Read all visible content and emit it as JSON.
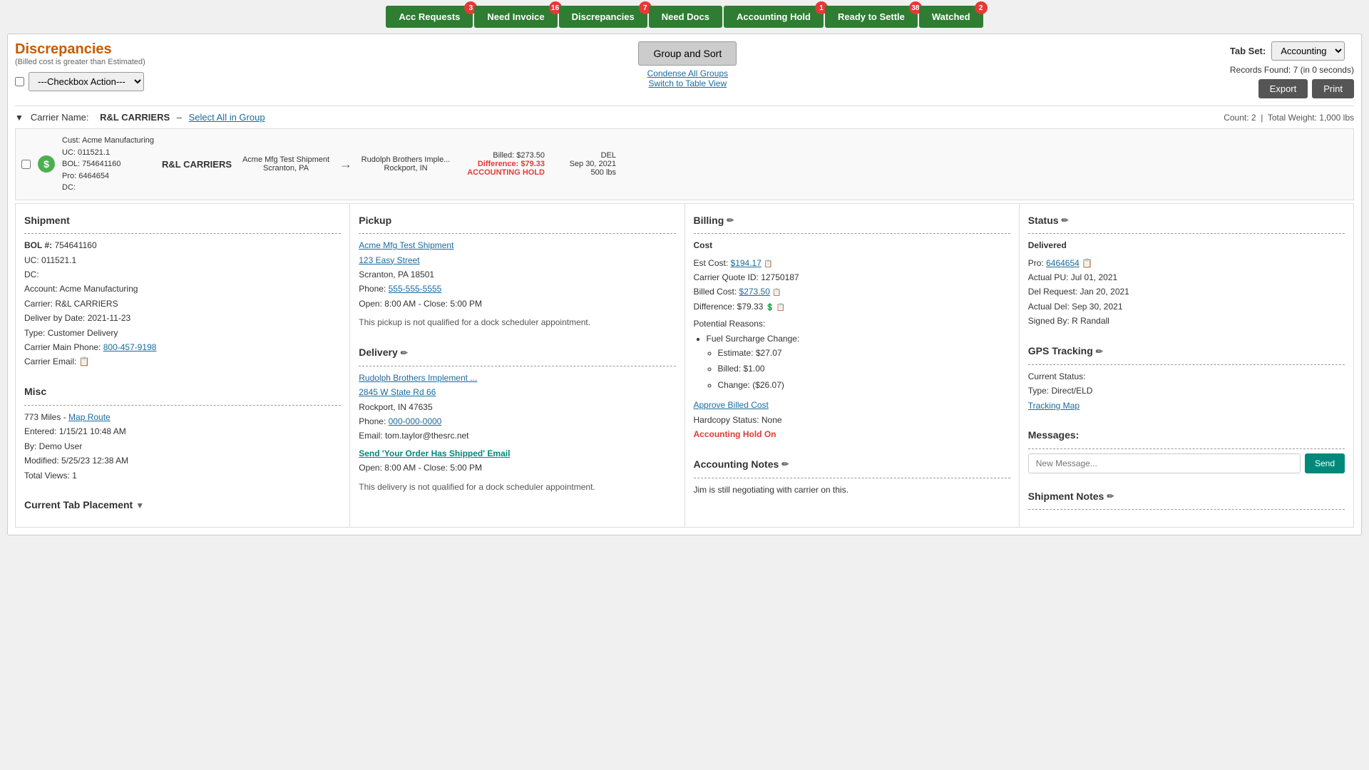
{
  "tabs": [
    {
      "id": "acc-requests",
      "label": "Acc Requests",
      "badge": "3",
      "active": false
    },
    {
      "id": "need-invoice",
      "label": "Need Invoice",
      "badge": "16",
      "active": false
    },
    {
      "id": "discrepancies",
      "label": "Discrepancies",
      "badge": "7",
      "active": true
    },
    {
      "id": "need-docs",
      "label": "Need Docs",
      "badge": "",
      "active": false
    },
    {
      "id": "accounting-hold",
      "label": "Accounting Hold",
      "badge": "1",
      "active": false
    },
    {
      "id": "ready-to-settle",
      "label": "Ready to Settle",
      "badge": "38",
      "active": false
    },
    {
      "id": "watched",
      "label": "Watched",
      "badge": "2",
      "active": false
    }
  ],
  "page": {
    "title": "Discrepancies",
    "subtitle": "(Billed cost is greater than Estimated)",
    "checkbox_action_default": "---Checkbox Action---",
    "group_sort_label": "Group and Sort",
    "condense_all": "Condense All Groups",
    "switch_table": "Switch to Table View",
    "tab_set_label": "Tab Set:",
    "tab_set_value": "Accounting",
    "records_found": "Records Found: 7 (in 0 seconds)",
    "export_label": "Export",
    "print_label": "Print"
  },
  "group": {
    "carrier_label": "Carrier Name:",
    "carrier_name": "R&L CARRIERS",
    "select_all": "Select All in Group",
    "count": "Count: 2",
    "total_weight": "Total Weight: 1,000 lbs"
  },
  "shipment_row": {
    "cust": "Cust: Acme Manufacturing",
    "uc": "UC: 011521.1",
    "bol": "BOL: 754641160",
    "pro": "Pro: 6464654",
    "dc": "DC:",
    "carrier": "R&L CARRIERS",
    "from_line1": "Acme Mfg Test Shipment",
    "from_line2": "Scranton, PA",
    "to_line1": "Rudolph Brothers Imple...",
    "to_line2": "Rockport, IN",
    "billed": "Billed: $273.50",
    "difference": "Difference: $79.33",
    "acct_hold": "ACCOUNTING HOLD",
    "del_label": "DEL",
    "del_date": "Sep 30, 2021",
    "del_weight": "500 lbs"
  },
  "shipment_panel": {
    "title": "Shipment",
    "bol_label": "BOL #:",
    "bol_value": "754641160",
    "uc_label": "UC:",
    "uc_value": "011521.1",
    "dc_label": "DC:",
    "dc_value": "",
    "account_label": "Account:",
    "account_value": "Acme Manufacturing",
    "carrier_label": "Carrier:",
    "carrier_value": "R&L CARRIERS",
    "deliver_by_label": "Deliver by Date:",
    "deliver_by_value": "2021-11-23",
    "type_label": "Type:",
    "type_value": "Customer Delivery",
    "carrier_phone_label": "Carrier Main Phone:",
    "carrier_phone_value": "800-457-9198",
    "carrier_email_label": "Carrier Email:",
    "carrier_email_value": "",
    "misc_title": "Misc",
    "miles_label": "773 Miles -",
    "miles_link": "Map Route",
    "entered_label": "Entered:",
    "entered_value": "1/15/21 10:48 AM",
    "by_label": "By:",
    "by_value": "Demo User",
    "modified_label": "Modified:",
    "modified_value": "5/25/23 12:38 AM",
    "views_label": "Total Views:",
    "views_value": "1",
    "current_tab_title": "Current Tab Placement"
  },
  "pickup_panel": {
    "title": "Pickup",
    "address_name": "Acme Mfg Test Shipment",
    "address_street": "123 Easy Street",
    "address_city": "Scranton, PA 18501",
    "phone_label": "Phone:",
    "phone_value": "555-555-5555",
    "hours": "Open: 8:00 AM - Close: 5:00 PM",
    "dock_note": "This pickup is not qualified for a dock scheduler appointment.",
    "delivery_title": "Delivery",
    "del_address_name": "Rudolph Brothers Implement ...",
    "del_address_street": "2845 W State Rd 66",
    "del_address_city": "Rockport, IN 47635",
    "del_phone_label": "Phone:",
    "del_phone_value": "000-000-0000",
    "del_email_label": "Email:",
    "del_email_value": "tom.taylor@thesrc.net",
    "del_send_link": "Send 'Your Order Has Shipped' Email",
    "del_hours": "Open: 8:00 AM - Close: 5:00 PM",
    "del_dock_note": "This delivery is not qualified for a dock scheduler appointment."
  },
  "billing_panel": {
    "title": "Billing",
    "cost_title": "Cost",
    "est_cost_label": "Est Cost:",
    "est_cost_value": "$194.17",
    "carrier_quote_label": "Carrier Quote ID:",
    "carrier_quote_value": "12750187",
    "billed_cost_label": "Billed Cost:",
    "billed_cost_value": "$273.50",
    "difference_label": "Difference:",
    "difference_value": "$79.33",
    "potential_label": "Potential Reasons:",
    "reasons": [
      {
        "reason": "Fuel Surcharge Change:",
        "sub": [
          "Estimate: $27.07",
          "Billed: $1.00",
          "Change: ($26.07)"
        ]
      }
    ],
    "approve_link": "Approve Billed Cost",
    "hardcopy_label": "Hardcopy Status:",
    "hardcopy_value": "None",
    "acct_hold_status": "Accounting Hold On",
    "acct_notes_title": "Accounting Notes",
    "acct_notes_text": "Jim is still negotiating with carrier on this."
  },
  "status_panel": {
    "title": "Status",
    "delivered_label": "Delivered",
    "pro_label": "Pro:",
    "pro_value": "6464654",
    "actual_pu_label": "Actual PU:",
    "actual_pu_value": "Jul 01, 2021",
    "del_request_label": "Del Request:",
    "del_request_value": "Jan 20, 2021",
    "actual_del_label": "Actual Del:",
    "actual_del_value": "Sep 30, 2021",
    "signed_by_label": "Signed By:",
    "signed_by_value": "R Randall",
    "gps_title": "GPS Tracking",
    "current_status_label": "Current Status:",
    "gps_type_label": "Type:",
    "gps_type_value": "Direct/ELD",
    "tracking_map_link": "Tracking Map",
    "messages_title": "Messages:",
    "message_placeholder": "New Message...",
    "send_label": "Send",
    "shipment_notes_title": "Shipment Notes"
  },
  "colors": {
    "green": "#2e7d32",
    "orange_title": "#c85a00",
    "red": "#e53935",
    "teal": "#00897b",
    "link_blue": "#1a6b9e"
  }
}
